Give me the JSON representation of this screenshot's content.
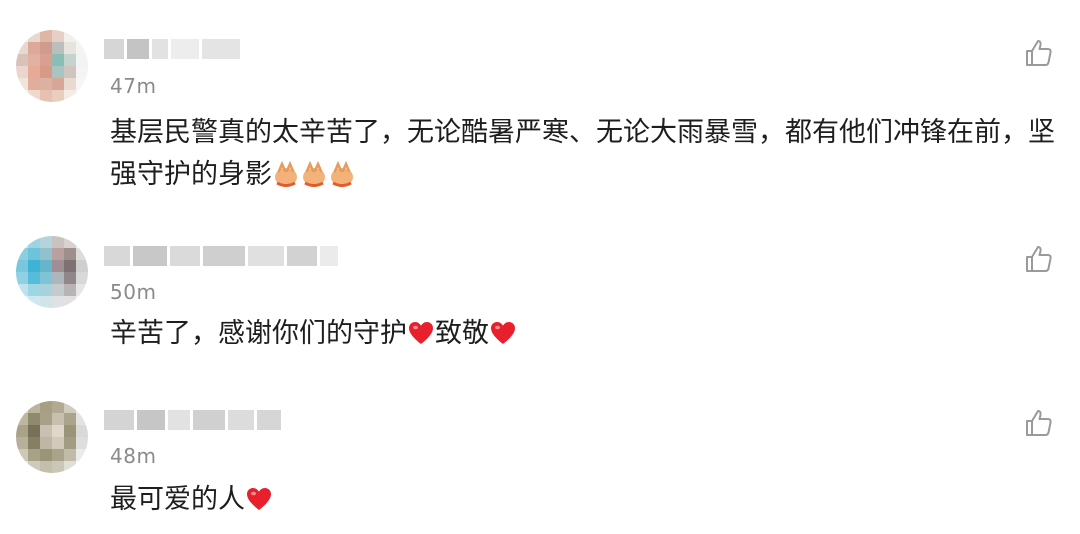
{
  "comments": [
    {
      "time": "47m",
      "text": "基层民警真的太辛苦了，无论酷暑严寒、无论大雨暴雪，都有他们冲锋在前，坚强守护的身影",
      "emojis": [
        "clap-hands",
        "clap-hands",
        "clap-hands"
      ]
    },
    {
      "time": "50m",
      "text_parts": [
        "辛苦了，感谢你们的守护",
        "致敬"
      ],
      "emojis": [
        "red-heart",
        "red-heart"
      ]
    },
    {
      "time": "48m",
      "text": "最可爱的人",
      "emojis": [
        "red-heart"
      ]
    }
  ],
  "colors": {
    "time": "#8a8a8a",
    "text": "#1e1e1e",
    "heart": "#e8202e",
    "like_icon": "#9a9a9a"
  },
  "icons": {
    "like": "thumbs-up-icon"
  }
}
